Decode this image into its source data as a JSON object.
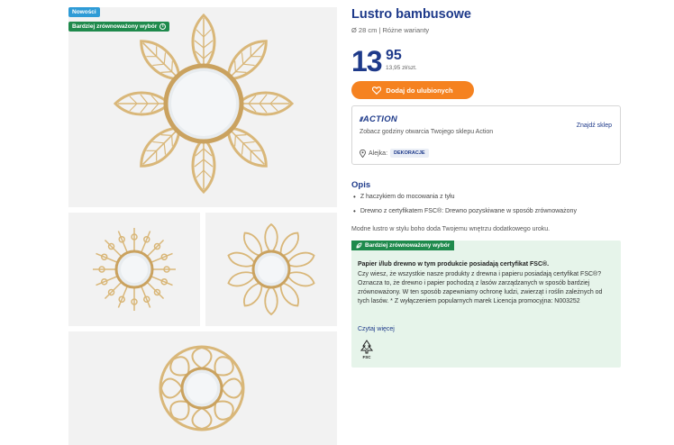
{
  "badges": {
    "new": "Nowości",
    "eco": "Bardziej zrównoważony wybór",
    "eco_info": "i"
  },
  "product": {
    "title": "Lustro bambusowe",
    "subtitle": "Ø 28 cm | Różne warianty",
    "price_main": "13",
    "price_decimal": "95",
    "price_unit": "13,95 zł/szt."
  },
  "favorite_button": {
    "label": "Dodaj do ulubionych",
    "icon": "heart-icon"
  },
  "store": {
    "logo": "ACTION",
    "text": "Zobacz godziny otwarcia Twojego sklepu Action",
    "find_label": "Znajdź sklep",
    "aisle_label": "Alejka:",
    "aisle_value": "DEKORACJE"
  },
  "description": {
    "title": "Opis",
    "bullets": [
      "Z haczykiem do mocowania z tyłu",
      "Drewno z certyfikatem FSC®: Drewno pozyskiwane w sposób zrównoważony"
    ],
    "text": "Modne lustro w stylu boho doda Twojemu wnętrzu dodatkowego uroku."
  },
  "eco_panel": {
    "tag": "Bardziej zrównoważony wybór",
    "heading": "Papier i/lub drewno w tym produkcie posiadają certyfikat FSC®.",
    "body": "Czy wiesz, że wszystkie nasze produkty z drewna i papieru posiadają certyfikat FSC®? Oznacza to, że drewno i papier pochodzą z lasów zarządzanych w sposób bardziej zrównoważony. W ten sposób zapewniamy ochronę ludzi, zwierząt i roślin zależnych od tych lasów. * Z wyłączeniem popularnych marek Licencja promocyjna: N003252",
    "read_more": "Czytaj więcej",
    "fsc_label": "FSC"
  },
  "colors": {
    "brand_blue": "#1e3a8a",
    "orange": "#f58220",
    "eco_green": "#1f8a4c",
    "eco_bg": "#e6f4ea",
    "rattan": "#d9b779"
  }
}
